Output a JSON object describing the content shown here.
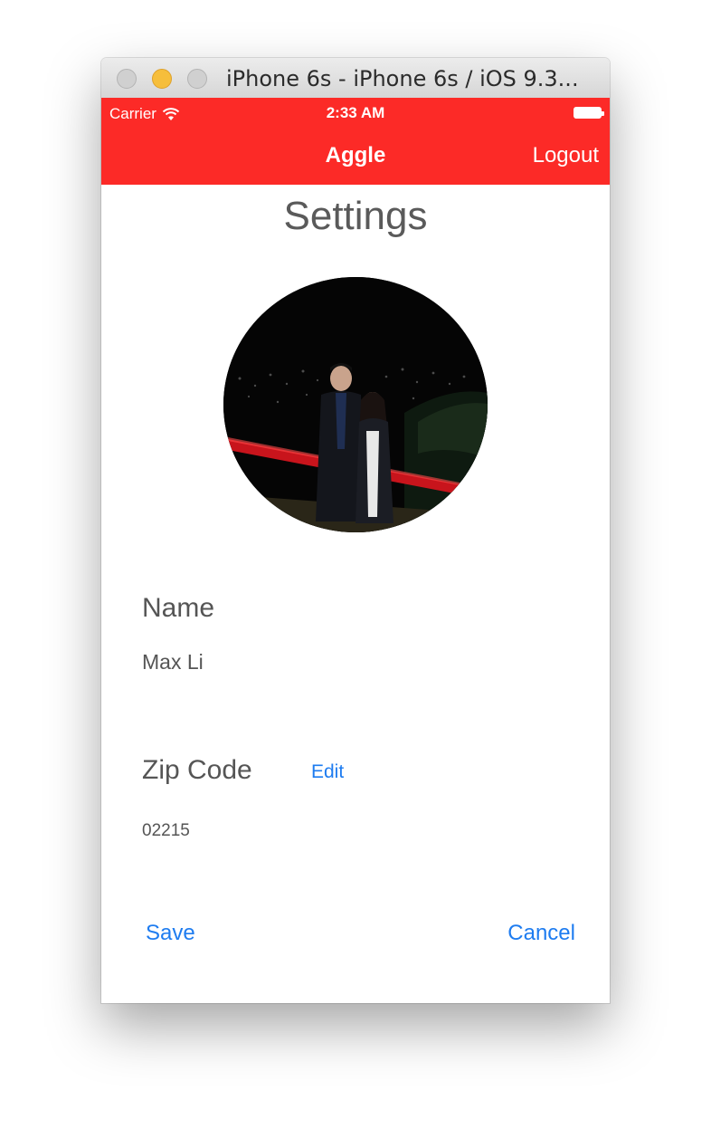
{
  "window": {
    "title": "iPhone 6s - iPhone 6s / iOS 9.3..."
  },
  "status_bar": {
    "carrier": "Carrier",
    "time": "2:33 AM",
    "battery_icon": "battery-full-icon",
    "wifi_icon": "wifi-icon"
  },
  "nav_bar": {
    "title": "Aggle",
    "logout_label": "Logout",
    "background_color": "#fc2a27"
  },
  "settings": {
    "page_title": "Settings",
    "name_label": "Name",
    "name_value": "Max Li",
    "zip_label": "Zip Code",
    "edit_label": "Edit",
    "zip_value": "02215",
    "save_label": "Save",
    "cancel_label": "Cancel",
    "accent_color": "#1e7cf0"
  }
}
